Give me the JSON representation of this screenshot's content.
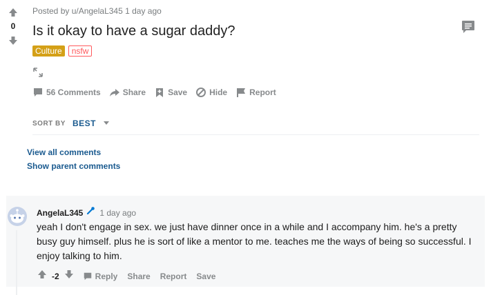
{
  "post": {
    "score": "0",
    "posted_by": "Posted by u/AngelaL345 1 day ago",
    "title": "Is it okay to have a sugar daddy?",
    "flairs": [
      "Culture",
      "nsfw"
    ],
    "actions": {
      "comments": "56 Comments",
      "share": "Share",
      "save": "Save",
      "hide": "Hide",
      "report": "Report"
    }
  },
  "sort": {
    "label": "SORT BY",
    "value": "BEST"
  },
  "links": {
    "view_all": "View all comments",
    "show_parent": "Show parent comments"
  },
  "comment": {
    "author": "AngelaL345",
    "time": "1 day ago",
    "body": "yeah I don't engage in sex. we just have dinner once in a while and I accompany him. he's a pretty busy guy himself. plus he is sort of like a mentor to me. teaches me the ways of being so successful. I enjoy talking to him.",
    "score": "-2",
    "actions": {
      "reply": "Reply",
      "share": "Share",
      "report": "Report",
      "save": "Save"
    }
  },
  "colors": {
    "link": "#1a5a8f",
    "flair_culture": "#d4a017",
    "nsfw": "#ff585b",
    "icon": "#878a8c",
    "op_badge": "#0079d3"
  },
  "icons": [
    "upvote-icon",
    "downvote-icon",
    "chat-icon",
    "expand-icon",
    "comment-icon",
    "share-icon",
    "save-icon",
    "hide-icon",
    "report-icon",
    "caret-down-icon",
    "avatar-icon",
    "op-badge-icon",
    "reply-icon"
  ]
}
